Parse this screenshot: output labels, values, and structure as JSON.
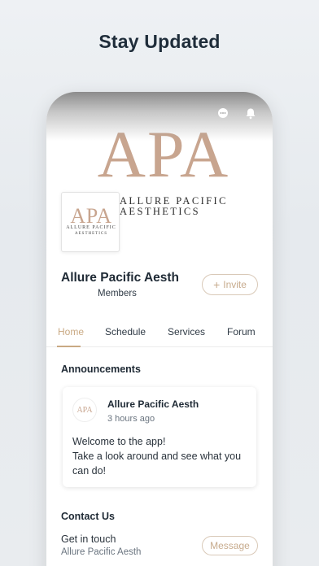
{
  "headline": "Stay Updated",
  "colors": {
    "accent": "#c9a983",
    "monogram": "#c8a58f"
  },
  "header": {
    "chat_icon": "chat-bubble-icon",
    "bell_icon": "bell-icon"
  },
  "cover": {
    "monogram": "APA",
    "line1": "ALLURE PACIFIC",
    "line2": "AESTHETICS"
  },
  "logo": {
    "monogram": "APA",
    "line1": "ALLURE PACIFIC",
    "line2": "AESTHETICS"
  },
  "group": {
    "name": "Allure Pacific Aesth",
    "members_label": "Members",
    "invite_label": "Invite",
    "invite_icon": "+"
  },
  "tabs": [
    {
      "label": "Home",
      "active": true
    },
    {
      "label": "Schedule",
      "active": false
    },
    {
      "label": "Services",
      "active": false
    },
    {
      "label": "Forum",
      "active": false
    }
  ],
  "announcements": {
    "title": "Announcements",
    "post": {
      "author": "Allure Pacific Aesth",
      "time": "3 hours ago",
      "avatar_text": "APA",
      "lines": [
        "Welcome to the app!",
        "Take a look around and see what you",
        "can do!"
      ]
    }
  },
  "contact": {
    "title": "Contact Us",
    "label": "Get in touch",
    "sub": "Allure Pacific Aesth",
    "button": "Message"
  }
}
